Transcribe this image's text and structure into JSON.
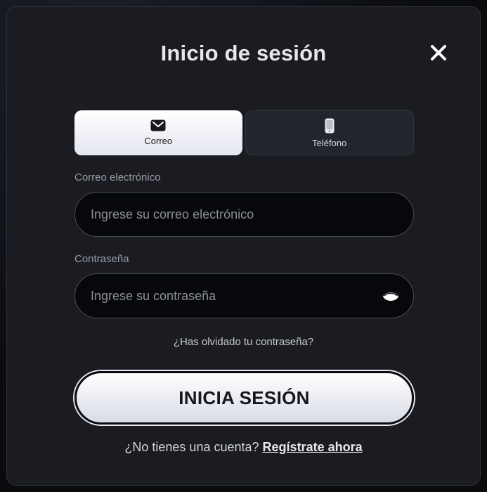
{
  "modal": {
    "title": "Inicio de sesión",
    "close_icon": "close-icon"
  },
  "tabs": [
    {
      "label": "Correo",
      "icon": "envelope-icon",
      "active": true
    },
    {
      "label": "Teléfono",
      "icon": "phone-icon",
      "active": false
    }
  ],
  "email": {
    "label": "Correo electrónico",
    "placeholder": "Ingrese su correo electrónico",
    "value": ""
  },
  "password": {
    "label": "Contraseña",
    "placeholder": "Ingrese su contraseña",
    "value": "",
    "toggle_icon": "eye-icon"
  },
  "forgot_label": "¿Has olvidado tu contraseña?",
  "login_label": "INICIA SESIÓN",
  "signup": {
    "prompt": "¿No tienes una cuenta?",
    "link": "Regístrate ahora"
  },
  "colors": {
    "modal_bg": "#1b1c21",
    "accent_light": "#ffffff",
    "text_primary": "#e7e8ee",
    "text_muted": "#9a9ca6"
  }
}
